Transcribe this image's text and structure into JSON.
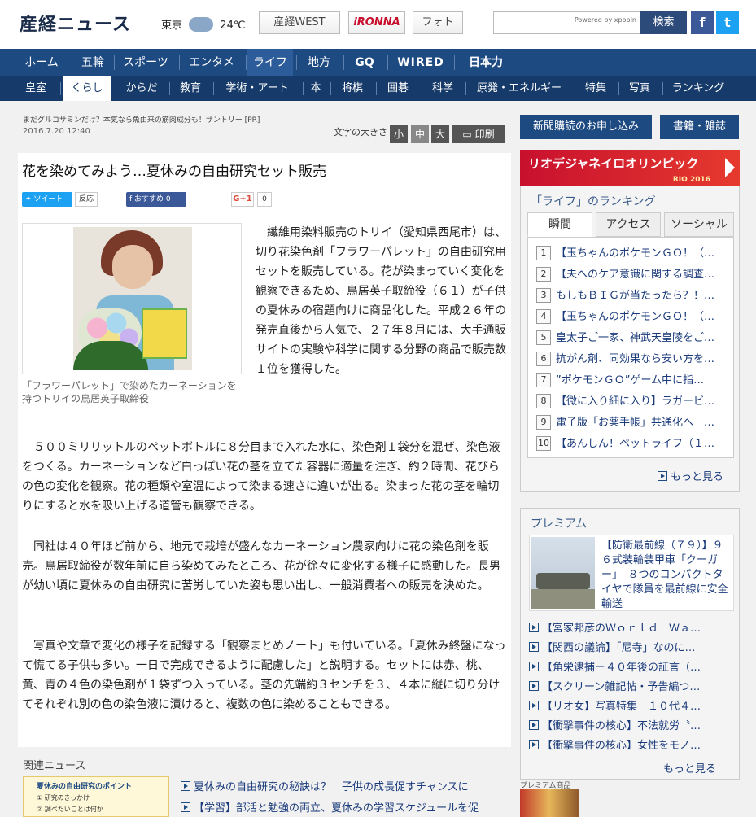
{
  "header": {
    "logo": "産経ニュース",
    "weather_city": "東京",
    "weather_temp": "24℃",
    "buttons": [
      "産経WEST",
      "iRONNA",
      "フォト"
    ],
    "search_powered": "Powered by xpopIn",
    "search_button": "検索"
  },
  "nav_main": [
    "ホーム",
    "五輪",
    "スポーツ",
    "エンタメ",
    "ライフ",
    "地方",
    "GQ",
    "WIRED",
    "日本力"
  ],
  "nav_sub": [
    "皇室",
    "くらし",
    "からだ",
    "教育",
    "学術・アート",
    "本",
    "将棋",
    "囲碁",
    "科学",
    "原発・エネルギー",
    "特集",
    "写真",
    "ランキング"
  ],
  "article": {
    "ad_line": "まだグルコサミンだけ？本気なら魚由来の筋肉成分も！サントリー [PR]",
    "date": "2016.7.20 12:40",
    "fontsize_label": "文字の大きさ",
    "font_small": "小",
    "font_mid": "中",
    "font_large": "大",
    "print": "印刷",
    "headline": "花を染めてみよう…夏休みの自由研究セット販売",
    "share_tw": "ツイート",
    "react": "反応",
    "share_fb": "おすすめ 0",
    "share_g": "G+1",
    "share_g_count": "0",
    "caption": "「フラワーパレット」で染めたカーネーションを持つトリイの鳥居英子取締役",
    "lead": "　繊維用染料販売のトリイ（愛知県西尾市）は、切り花染色剤「フラワーパレット」の自由研究用セットを販売している。花が染まっていく変化を観察できるため、鳥居英子取締役（６１）が子供の夏休みの宿題向けに商品化した。平成２６年の発売直後から人気で、２７年８月には、大手通販サイトの実験や科学に関する分野の商品で販売数１位を獲得した。",
    "p1": "　５００ミリリットルのペットボトルに８分目まで入れた水に、染色剤１袋分を混ぜ、染色液をつくる。カーネーションなど白っぽい花の茎を立てた容器に適量を注ぎ、約２時間、花びらの色の変化を観察。花の種類や室温によって染まる速さに違いが出る。染まった花の茎を輪切りにすると水を吸い上げる道管も観察できる。",
    "p2": "　同社は４０年ほど前から、地元で栽培が盛んなカーネーション農家向けに花の染色剤を販売。鳥居取締役が数年前に自ら染めてみたところ、花が徐々に変化する様子に感動した。長男が幼い頃に夏休みの自由研究に苦労していた姿も思い出し、一般消費者への販売を決めた。",
    "p3": "　写真や文章で変化の様子を記録する「観察まとめノート」も付いている。「夏休み終盤になって慌てる子供も多い。一日で完成できるように配慮した」と説明する。セットには赤、桃、黄、青の４色の染色剤が１袋ずつ入っている。茎の先端約３センチを３、４本に縦に切り分けてそれぞれ別の色の染色液に漬けると、複数の色に染めることもできる。"
  },
  "related": {
    "title": "関連ニュース",
    "thumb_title": "夏休みの自由研究のポイント",
    "thumb_l1": "① 研究のきっかけ",
    "thumb_l2": "② 調べたいことは何か",
    "items": [
      "夏休みの自由研究の秘訣は？　子供の成長促すチャンスに",
      "【学習】部活と勉強の両立、夏休みの学習スケジュールを促"
    ]
  },
  "sidebar": {
    "subscribe": "新聞購読のお申し込み",
    "books": "書籍・雑誌",
    "olympic": "リオデジャネイロオリンピック",
    "olympic_sub": "RIO 2016",
    "ranking_title": "「ライフ」のランキング",
    "tabs": [
      "瞬間",
      "アクセス",
      "ソーシャル"
    ],
    "ranking": [
      "【玉ちゃんのポケモンＧＯ！（…",
      "【夫へのケア意識に関する調査…",
      "もしもＢＩＧが当たったら？！…",
      "【玉ちゃんのポケモンＧＯ！（…",
      "皇太子ご一家、神武天皇陵をご…",
      "抗がん剤、同効果なら安い方を…",
      "”ポケモンＧＯ”ゲーム中に指…",
      "【微に入り細に入り】ラガービ…",
      "電子版「お薬手帳」共通化へ　…",
      "【あんしん！ペットライフ（１…"
    ],
    "more": "もっと見る",
    "premium_title": "プレミアム",
    "premium_feature": "【防衛最前線（７９）】９６式装輪装甲車「クーガー」　８つのコンパクトタイヤで隊員を最前線に安全輸送",
    "premium_items": [
      "【宮家邦彦のＷｏｒｌｄ　Ｗａ…",
      "【関西の議論】「尼寺」なのに…",
      "【角栄逮捕－４０年後の証言（…",
      "【スクリーン雑記帖・予告編つ…",
      "【リオ女】写真特集　１０代４…",
      "【衝撃事件の核心】不法就労〝…",
      "【衝撃事件の核心】女性をモノ…"
    ],
    "premium_more": "もっと見る",
    "premium_small": "プレミアム商品"
  }
}
